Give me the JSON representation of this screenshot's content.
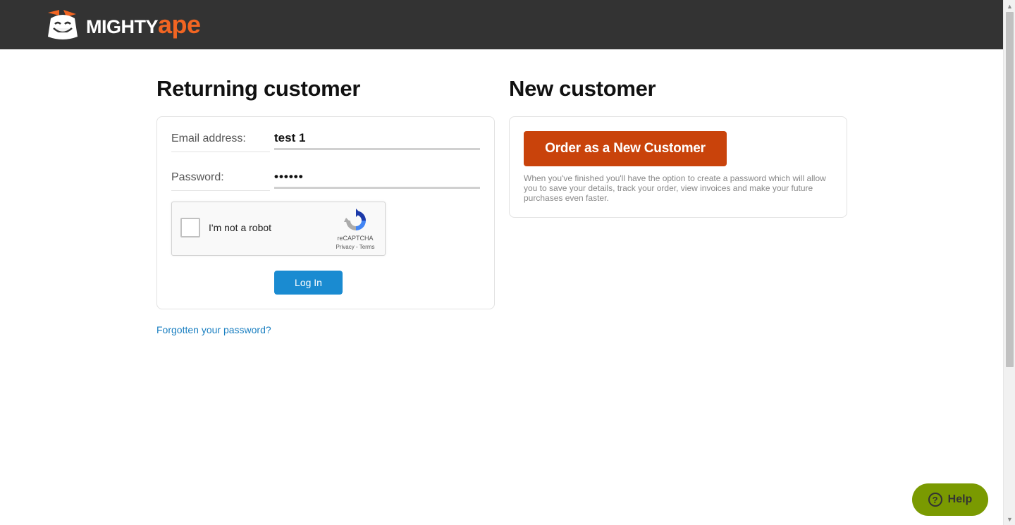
{
  "header": {
    "logo_mighty": "MIGHTY",
    "logo_ape": "ape",
    "logo_icon": "gorilla-mascot-icon"
  },
  "returning": {
    "heading": "Returning customer",
    "email_label": "Email address:",
    "email_value": "test 1",
    "password_label": "Password:",
    "password_value": "••••••",
    "recaptcha": {
      "label": "I'm not a robot",
      "brand": "reCAPTCHA",
      "links": "Privacy - Terms"
    },
    "login_button": "Log In",
    "forgot_link": "Forgotten your password?"
  },
  "new_customer": {
    "heading": "New customer",
    "order_button": "Order as a New Customer",
    "description": "When you've finished you'll have the option to create a password which will allow you to save your details, track your order, view invoices and make your future purchases even faster."
  },
  "help": {
    "label": "Help",
    "icon": "question-circle-icon"
  },
  "colors": {
    "header_bg": "#333333",
    "brand_orange": "#f26522",
    "order_button": "#c9430b",
    "login_button": "#1a8bd1",
    "help_button": "#7a9a01",
    "link": "#1a7fc1"
  }
}
